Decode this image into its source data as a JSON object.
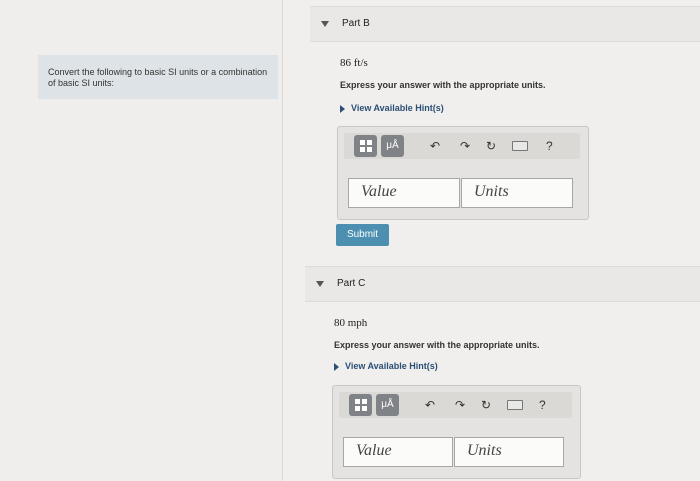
{
  "instruction": "Convert the following to basic SI units or a combination of basic SI units:",
  "parts": [
    {
      "title": "Part B",
      "value": "86 ft/s",
      "prompt": "Express your answer with the appropriate units.",
      "hint_label": "View Available Hint(s)",
      "value_placeholder": "Value",
      "units_placeholder": "Units",
      "submit_label": "Submit"
    },
    {
      "title": "Part C",
      "value": "80 mph",
      "prompt": "Express your answer with the appropriate units.",
      "hint_label": "View Available Hint(s)",
      "value_placeholder": "Value",
      "units_placeholder": "Units"
    }
  ],
  "toolbar": {
    "units_button": "μÅ",
    "help": "?"
  },
  "icons": {
    "template": "fraction-template-icon",
    "undo": "undo-icon",
    "redo": "redo-icon",
    "reset": "reset-icon",
    "keyboard": "keyboard-icon",
    "help": "help-icon"
  }
}
